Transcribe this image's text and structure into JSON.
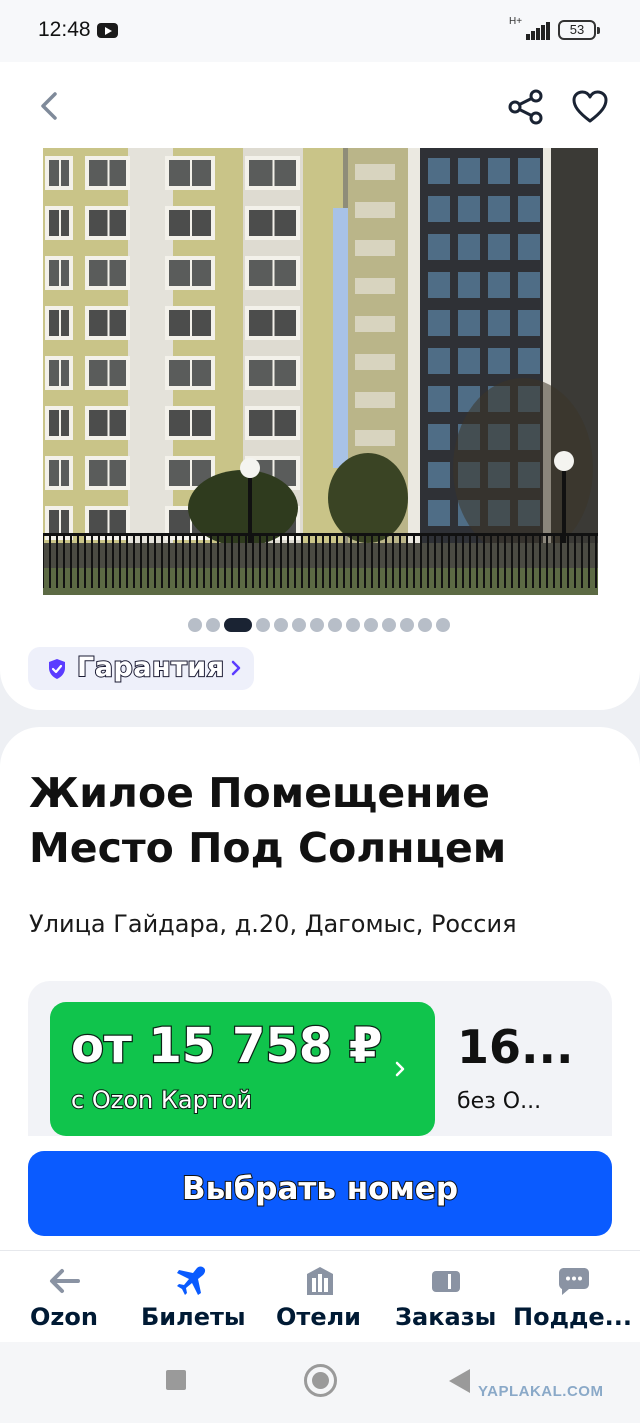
{
  "status_bar": {
    "time": "12:48",
    "network": "H+",
    "battery": "53"
  },
  "gallery": {
    "dot_count": 14,
    "active_dot": 2
  },
  "guarantee": {
    "label": "Гарантия"
  },
  "hotel": {
    "title": "Жилое Помещение Место Под Солнцем",
    "address": "Улица Гайдара, д.20, Дагомыс, Россия"
  },
  "price": {
    "main": "от 15 758 ₽",
    "main_sub": "с Ozon Картой",
    "alt": "16...",
    "alt_sub": "без О..."
  },
  "select_button": {
    "label": "Выбрать номер"
  },
  "tabbar": {
    "items": [
      {
        "label": "Ozon",
        "icon": "arrow-left-icon"
      },
      {
        "label": "Билеты",
        "icon": "airplane-icon"
      },
      {
        "label": "Отели",
        "icon": "hotel-icon"
      },
      {
        "label": "Заказы",
        "icon": "orders-icon"
      },
      {
        "label": "Подде...",
        "icon": "chat-icon"
      }
    ]
  },
  "watermark": "YAPLAKAL.COM",
  "colors": {
    "accent_blue": "#0a5bff",
    "price_green": "#10c44c",
    "guarantee_purple": "#5b3cff"
  }
}
